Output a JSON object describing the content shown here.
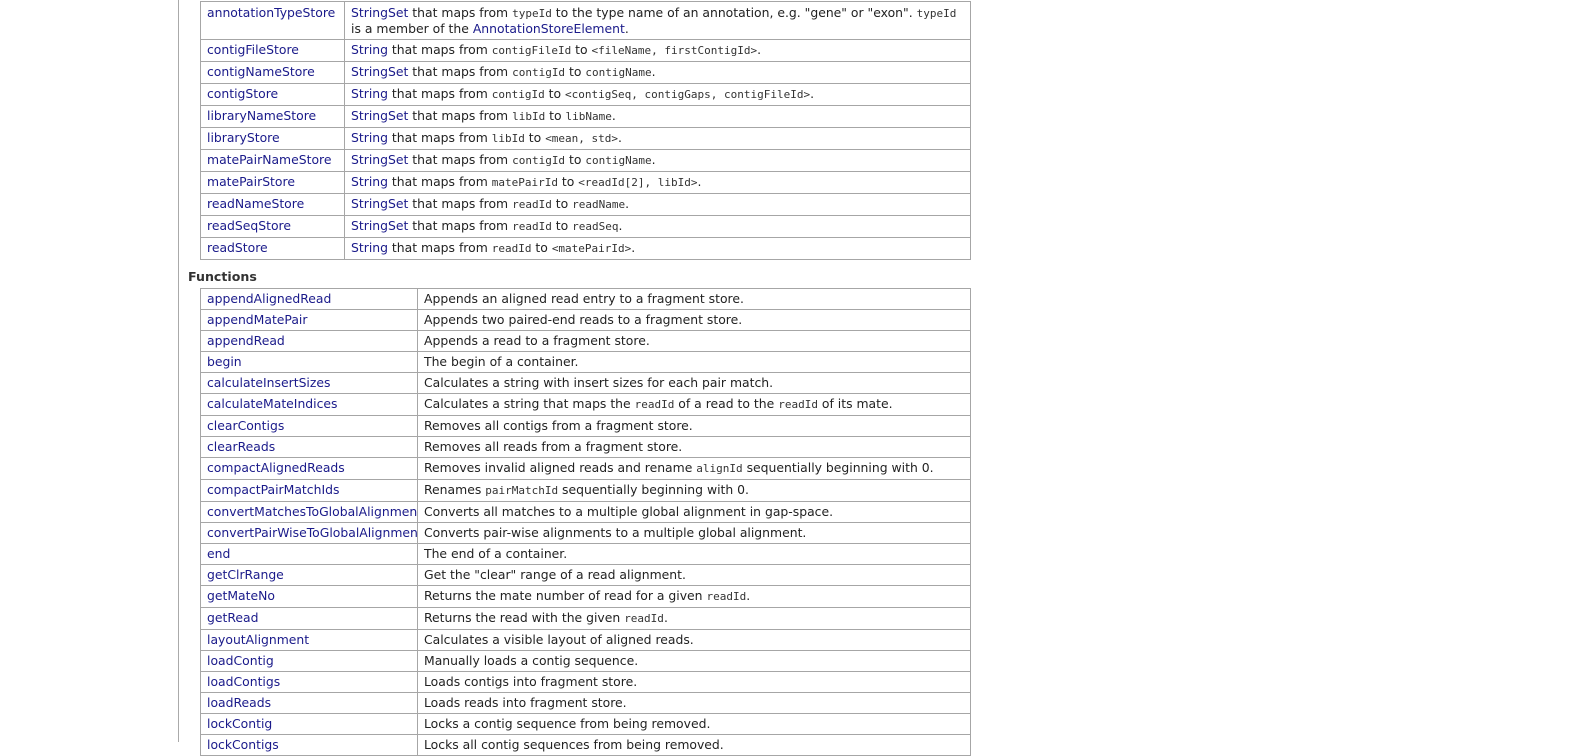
{
  "members": [
    {
      "name": "annotationTypeStore",
      "parts": [
        {
          "type": "link",
          "text": "StringSet"
        },
        {
          "type": "text",
          "text": " that maps from "
        },
        {
          "type": "code",
          "text": "typeId"
        },
        {
          "type": "text",
          "text": " to the type name of an annotation, e.g. \"gene\" or \"exon\". "
        },
        {
          "type": "code",
          "text": "typeId"
        },
        {
          "type": "text",
          "text": " is a member of the "
        },
        {
          "type": "link",
          "text": "AnnotationStoreElement"
        },
        {
          "type": "text",
          "text": "."
        }
      ]
    },
    {
      "name": "contigFileStore",
      "parts": [
        {
          "type": "link",
          "text": "String"
        },
        {
          "type": "text",
          "text": " that maps from "
        },
        {
          "type": "code",
          "text": "contigFileId"
        },
        {
          "type": "text",
          "text": " to "
        },
        {
          "type": "code",
          "text": "<fileName, firstContigId>"
        },
        {
          "type": "text",
          "text": "."
        }
      ]
    },
    {
      "name": "contigNameStore",
      "parts": [
        {
          "type": "link",
          "text": "StringSet"
        },
        {
          "type": "text",
          "text": " that maps from "
        },
        {
          "type": "code",
          "text": "contigId"
        },
        {
          "type": "text",
          "text": " to "
        },
        {
          "type": "code",
          "text": "contigName"
        },
        {
          "type": "text",
          "text": "."
        }
      ]
    },
    {
      "name": "contigStore",
      "parts": [
        {
          "type": "link",
          "text": "String"
        },
        {
          "type": "text",
          "text": " that maps from "
        },
        {
          "type": "code",
          "text": "contigId"
        },
        {
          "type": "text",
          "text": " to "
        },
        {
          "type": "code",
          "text": "<contigSeq, contigGaps, contigFileId>"
        },
        {
          "type": "text",
          "text": "."
        }
      ]
    },
    {
      "name": "libraryNameStore",
      "parts": [
        {
          "type": "link",
          "text": "StringSet"
        },
        {
          "type": "text",
          "text": " that maps from "
        },
        {
          "type": "code",
          "text": "libId"
        },
        {
          "type": "text",
          "text": " to "
        },
        {
          "type": "code",
          "text": "libName"
        },
        {
          "type": "text",
          "text": "."
        }
      ]
    },
    {
      "name": "libraryStore",
      "parts": [
        {
          "type": "link",
          "text": "String"
        },
        {
          "type": "text",
          "text": " that maps from "
        },
        {
          "type": "code",
          "text": "libId"
        },
        {
          "type": "text",
          "text": " to "
        },
        {
          "type": "code",
          "text": "<mean, std>"
        },
        {
          "type": "text",
          "text": "."
        }
      ]
    },
    {
      "name": "matePairNameStore",
      "parts": [
        {
          "type": "link",
          "text": "StringSet"
        },
        {
          "type": "text",
          "text": " that maps from "
        },
        {
          "type": "code",
          "text": "contigId"
        },
        {
          "type": "text",
          "text": " to "
        },
        {
          "type": "code",
          "text": "contigName"
        },
        {
          "type": "text",
          "text": "."
        }
      ]
    },
    {
      "name": "matePairStore",
      "parts": [
        {
          "type": "link",
          "text": "String"
        },
        {
          "type": "text",
          "text": " that maps from "
        },
        {
          "type": "code",
          "text": "matePairId"
        },
        {
          "type": "text",
          "text": " to "
        },
        {
          "type": "code",
          "text": "<readId[2], libId>"
        },
        {
          "type": "text",
          "text": "."
        }
      ]
    },
    {
      "name": "readNameStore",
      "parts": [
        {
          "type": "link",
          "text": "StringSet"
        },
        {
          "type": "text",
          "text": " that maps from "
        },
        {
          "type": "code",
          "text": "readId"
        },
        {
          "type": "text",
          "text": " to "
        },
        {
          "type": "code",
          "text": "readName"
        },
        {
          "type": "text",
          "text": "."
        }
      ]
    },
    {
      "name": "readSeqStore",
      "parts": [
        {
          "type": "link",
          "text": "StringSet"
        },
        {
          "type": "text",
          "text": " that maps from "
        },
        {
          "type": "code",
          "text": "readId"
        },
        {
          "type": "text",
          "text": " to "
        },
        {
          "type": "code",
          "text": "readSeq"
        },
        {
          "type": "text",
          "text": "."
        }
      ]
    },
    {
      "name": "readStore",
      "parts": [
        {
          "type": "link",
          "text": "String"
        },
        {
          "type": "text",
          "text": " that maps from "
        },
        {
          "type": "code",
          "text": "readId"
        },
        {
          "type": "text",
          "text": " to "
        },
        {
          "type": "code",
          "text": "<matePairId>"
        },
        {
          "type": "text",
          "text": "."
        }
      ]
    }
  ],
  "functions_heading": "Functions",
  "functions": [
    {
      "name": "appendAlignedRead",
      "parts": [
        {
          "type": "text",
          "text": "Appends an aligned read entry to a fragment store."
        }
      ]
    },
    {
      "name": "appendMatePair",
      "parts": [
        {
          "type": "text",
          "text": "Appends two paired-end reads to a fragment store."
        }
      ]
    },
    {
      "name": "appendRead",
      "parts": [
        {
          "type": "text",
          "text": "Appends a read to a fragment store."
        }
      ]
    },
    {
      "name": "begin",
      "parts": [
        {
          "type": "text",
          "text": "The begin of a container."
        }
      ]
    },
    {
      "name": "calculateInsertSizes",
      "parts": [
        {
          "type": "text",
          "text": "Calculates a string with insert sizes for each pair match."
        }
      ]
    },
    {
      "name": "calculateMateIndices",
      "parts": [
        {
          "type": "text",
          "text": "Calculates a string that maps the "
        },
        {
          "type": "code",
          "text": "readId"
        },
        {
          "type": "text",
          "text": " of a read to the "
        },
        {
          "type": "code",
          "text": "readId"
        },
        {
          "type": "text",
          "text": " of its mate."
        }
      ]
    },
    {
      "name": "clearContigs",
      "parts": [
        {
          "type": "text",
          "text": "Removes all contigs from a fragment store."
        }
      ]
    },
    {
      "name": "clearReads",
      "parts": [
        {
          "type": "text",
          "text": "Removes all reads from a fragment store."
        }
      ]
    },
    {
      "name": "compactAlignedReads",
      "parts": [
        {
          "type": "text",
          "text": "Removes invalid aligned reads and rename "
        },
        {
          "type": "code",
          "text": "alignId"
        },
        {
          "type": "text",
          "text": " sequentially beginning with 0."
        }
      ]
    },
    {
      "name": "compactPairMatchIds",
      "parts": [
        {
          "type": "text",
          "text": "Renames "
        },
        {
          "type": "code",
          "text": "pairMatchId"
        },
        {
          "type": "text",
          "text": " sequentially beginning with 0."
        }
      ]
    },
    {
      "name": "convertMatchesToGlobalAlignment",
      "parts": [
        {
          "type": "text",
          "text": "Converts all matches to a multiple global alignment in gap-space."
        }
      ]
    },
    {
      "name": "convertPairWiseToGlobalAlignment",
      "parts": [
        {
          "type": "text",
          "text": "Converts pair-wise alignments to a multiple global alignment."
        }
      ]
    },
    {
      "name": "end",
      "parts": [
        {
          "type": "text",
          "text": "The end of a container."
        }
      ]
    },
    {
      "name": "getClrRange",
      "parts": [
        {
          "type": "text",
          "text": "Get the \"clear\" range of a read alignment."
        }
      ]
    },
    {
      "name": "getMateNo",
      "parts": [
        {
          "type": "text",
          "text": "Returns the mate number of read for a given "
        },
        {
          "type": "code",
          "text": "readId"
        },
        {
          "type": "text",
          "text": "."
        }
      ]
    },
    {
      "name": "getRead",
      "parts": [
        {
          "type": "text",
          "text": "Returns the read with the given "
        },
        {
          "type": "code",
          "text": "readId"
        },
        {
          "type": "text",
          "text": "."
        }
      ]
    },
    {
      "name": "layoutAlignment",
      "parts": [
        {
          "type": "text",
          "text": "Calculates a visible layout of aligned reads."
        }
      ]
    },
    {
      "name": "loadContig",
      "parts": [
        {
          "type": "text",
          "text": "Manually loads a contig sequence."
        }
      ]
    },
    {
      "name": "loadContigs",
      "parts": [
        {
          "type": "text",
          "text": "Loads contigs into fragment store."
        }
      ]
    },
    {
      "name": "loadReads",
      "parts": [
        {
          "type": "text",
          "text": "Loads reads into fragment store."
        }
      ]
    },
    {
      "name": "lockContig",
      "parts": [
        {
          "type": "text",
          "text": "Locks a contig sequence from being removed."
        }
      ]
    },
    {
      "name": "lockContigs",
      "parts": [
        {
          "type": "text",
          "text": "Locks all contig sequences from being removed."
        }
      ]
    }
  ]
}
